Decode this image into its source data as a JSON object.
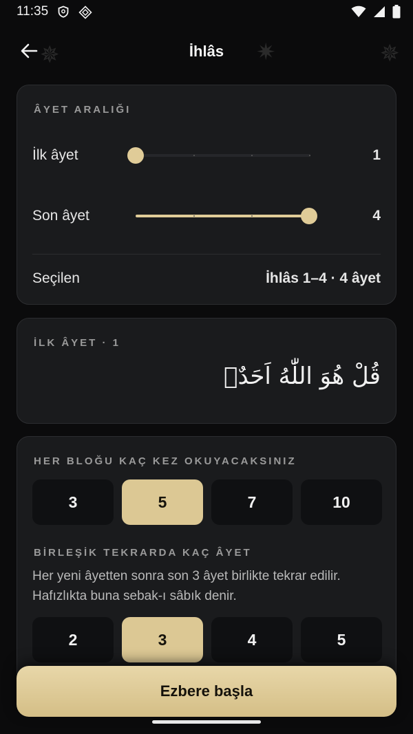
{
  "status": {
    "time": "11:35"
  },
  "header": {
    "title": "İhlâs"
  },
  "range_card": {
    "section_label": "ÂYET ARALIĞI",
    "first": {
      "label": "İlk âyet",
      "value": "1"
    },
    "last": {
      "label": "Son âyet",
      "value": "4"
    },
    "selected": {
      "label": "Seçilen",
      "value": "İhlâs 1–4 · 4 âyet"
    }
  },
  "preview_card": {
    "section_label": "İLK ÂYET · 1",
    "arabic": "قُلْ هُوَ اللّٰهُ اَحَدٌۚ"
  },
  "settings_card": {
    "repeat_label": "HER BLOĞU KAÇ KEZ OKUYACAKSINIZ",
    "repeat_options": [
      "3",
      "5",
      "7",
      "10"
    ],
    "repeat_selected": "5",
    "combined_label": "BİRLEŞİK TEKRARDA KAÇ ÂYET",
    "combined_help": "Her yeni âyetten sonra son 3 âyet birlikte tekrar edilir. Hafızlıkta buna sebak-ı sâbık denir.",
    "combined_options": [
      "2",
      "3",
      "4",
      "5"
    ],
    "combined_selected": "3"
  },
  "footer": {
    "start_label": "Ezbere başla"
  },
  "colors": {
    "accent": "#dcc894",
    "card": "#1a1b1d",
    "background": "#0b0b0c"
  }
}
